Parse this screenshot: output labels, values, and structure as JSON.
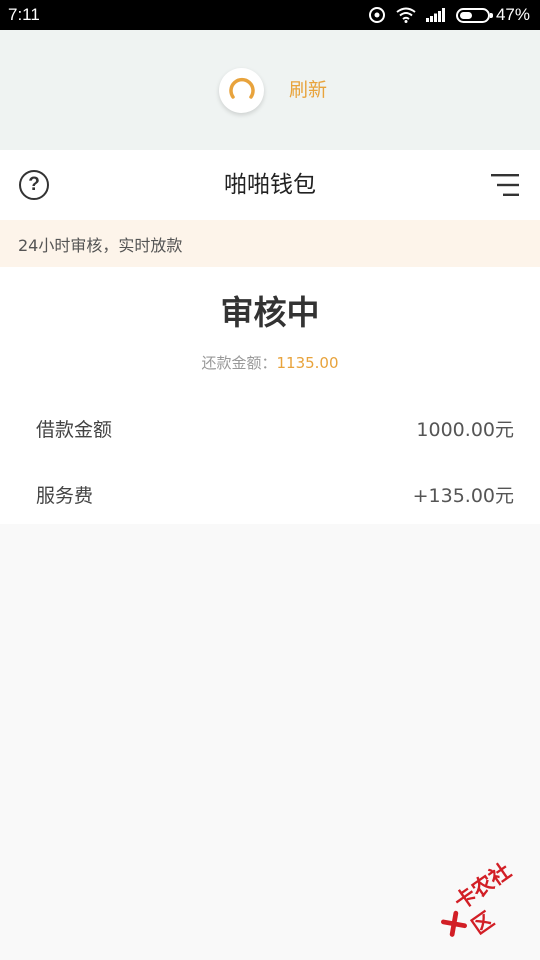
{
  "status_bar": {
    "time": "7:11",
    "battery": "47%",
    "battery_level": 0.47
  },
  "refresh": {
    "label": "刷新",
    "accent_color": "#e8a33c"
  },
  "nav": {
    "help_glyph": "?",
    "title": "啪啪钱包"
  },
  "notice": {
    "text": "24小时审核，实时放款"
  },
  "status": {
    "title": "审核中",
    "repay_label": "还款金额：",
    "repay_amount": "1135.00"
  },
  "rows": [
    {
      "label": "借款金额",
      "value": "1000.00元"
    },
    {
      "label": "服务费",
      "value": "+135.00元"
    }
  ],
  "watermark": {
    "text": "卡农社区",
    "color": "#d21f26"
  },
  "icons": [
    "spinner-icon",
    "help-icon",
    "menu-icon",
    "wifi-icon",
    "signal-icon",
    "location-icon",
    "battery-icon"
  ]
}
